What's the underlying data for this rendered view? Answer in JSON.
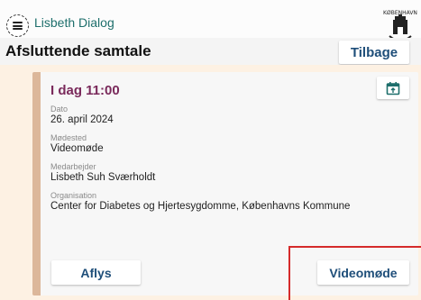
{
  "header": {
    "app_title": "Lisbeth Dialog",
    "menu_icon": "hamburger-menu-icon",
    "logo_icon": "copenhagen-municipality-logo"
  },
  "page": {
    "title": "Afsluttende samtale",
    "back_label": "Tilbage"
  },
  "appointment": {
    "time": "I dag 11:00",
    "calendar_icon": "calendar-export-icon",
    "fields": [
      {
        "label": "Dato",
        "value": "26. april 2024"
      },
      {
        "label": "Mødested",
        "value": "Videomøde"
      },
      {
        "label": "Medarbejder",
        "value": "Lisbeth Suh Sværholdt"
      },
      {
        "label": "Organisation",
        "value": "Center for Diabetes og Hjertesygdomme, Københavns Kommune"
      }
    ],
    "cancel_label": "Aflys",
    "video_label": "Videomøde"
  },
  "colors": {
    "header_title": "#1e6f6c",
    "time_accent": "#7a2a5b",
    "button_text": "#1e4e79",
    "card_stripe": "#dcb79a",
    "card_bg": "#fdf1e3",
    "highlight": "#d52b2b"
  }
}
